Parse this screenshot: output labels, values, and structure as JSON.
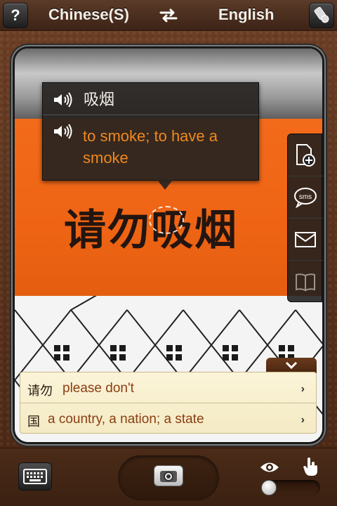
{
  "topbar": {
    "help_label": "?",
    "source_language": "Chinese(S)",
    "target_language": "English",
    "swap_icon": "swap-arrows-icon",
    "erase_icon": "eraser-icon"
  },
  "camera": {
    "sign_text": "请勿吸烟"
  },
  "popup": {
    "word": "吸烟",
    "definition": "to smoke; to have a smoke"
  },
  "sidebar": {
    "items": [
      {
        "name": "add-document",
        "icon": "add-document-icon"
      },
      {
        "name": "sms",
        "icon": "sms-icon",
        "label": "sms"
      },
      {
        "name": "email",
        "icon": "envelope-icon"
      },
      {
        "name": "dictionary",
        "icon": "book-icon"
      }
    ]
  },
  "results": {
    "items": [
      {
        "word": "请勿",
        "definition": "please don't"
      },
      {
        "word": "国",
        "definition": "a country, a nation; a state"
      }
    ]
  },
  "bottombar": {
    "keyboard_icon": "keyboard-icon",
    "shutter_icon": "camera-icon",
    "mode_left_icon": "eye-icon",
    "mode_right_icon": "hand-pointer-icon"
  },
  "colors": {
    "accent_orange": "#f0891f",
    "definition_brown": "#8a3e12",
    "sign_orange": "#f26b1a"
  }
}
